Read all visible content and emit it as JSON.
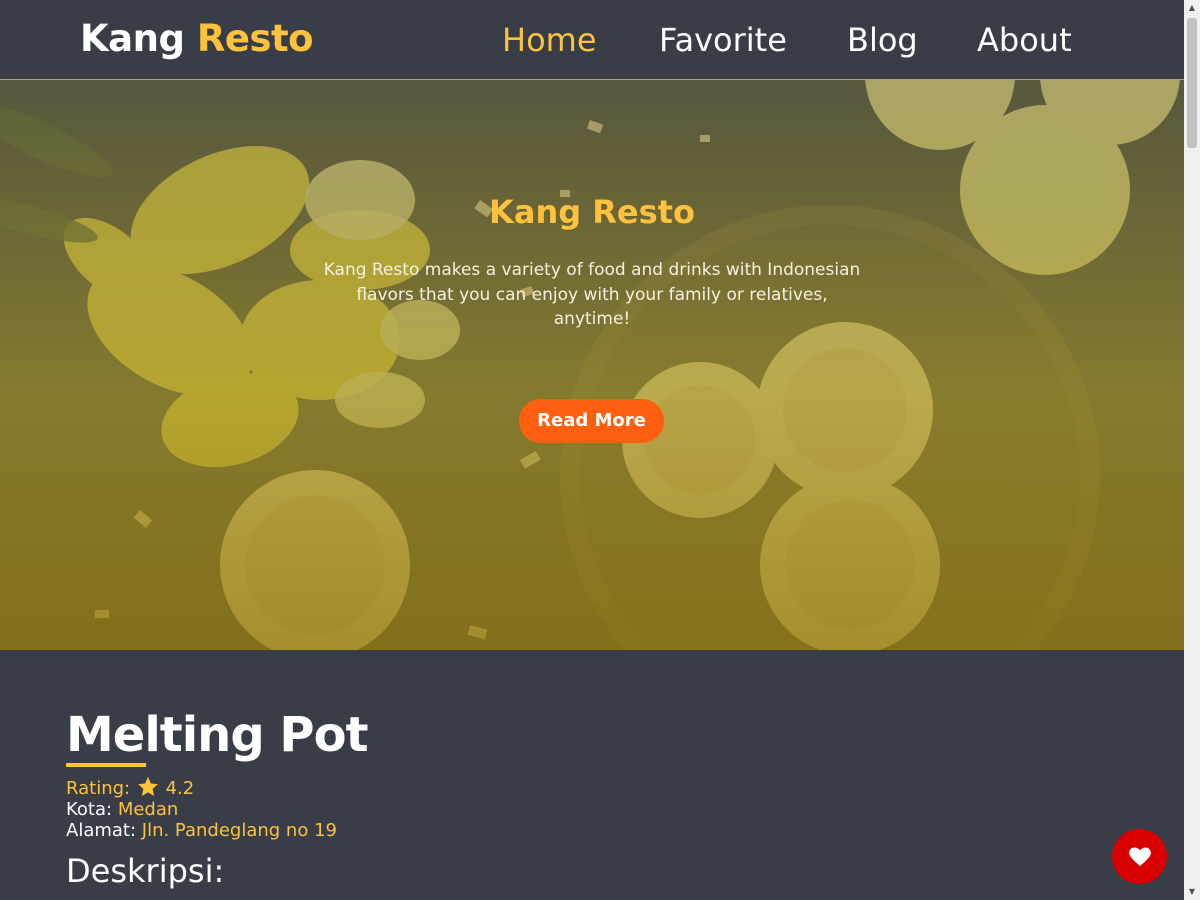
{
  "header": {
    "brand_part1": "Kang",
    "brand_part2": "Resto",
    "nav": [
      "Home",
      "Favorite",
      "Blog",
      "About"
    ],
    "active_nav": "Home"
  },
  "hero": {
    "title": "Kang Resto",
    "text": "Kang Resto makes a variety of food and drinks with Indonesian flavors that you can enjoy with your family or relatives, anytime!",
    "button_label": "Read More"
  },
  "restaurant": {
    "name": "Melting Pot",
    "rating_label": "Rating:",
    "rating_value": "4.2",
    "city_label": "Kota:",
    "city_value": "Medan",
    "address_label": "Alamat:",
    "address_value": "Jln. Pandeglang no 19",
    "description_heading": "Deskripsi:"
  },
  "icons": {
    "rating": "star-icon",
    "favorite": "heart-icon"
  },
  "colors": {
    "accent": "#ffc23c",
    "header_bg": "#383d48",
    "button": "#ff5f0f",
    "favorite": "#d80000"
  }
}
